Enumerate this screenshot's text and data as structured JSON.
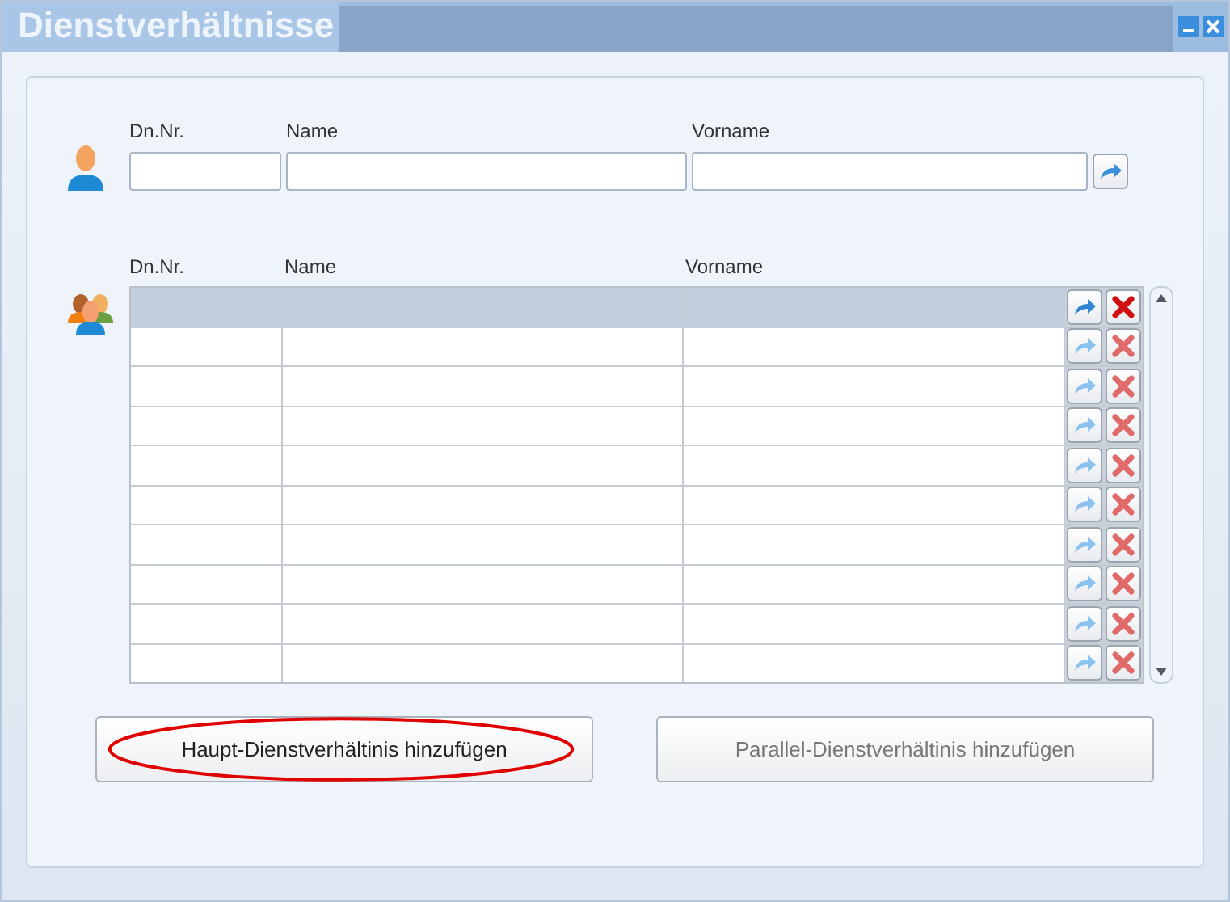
{
  "window": {
    "title": "Dienstverhältnisse"
  },
  "search": {
    "columns": [
      "Dn.Nr.",
      "Name",
      "Vorname"
    ]
  },
  "table": {
    "columns": [
      "Dn.Nr.",
      "Name",
      "Vorname"
    ],
    "rows": [
      {
        "selected": true
      },
      {
        "selected": false
      },
      {
        "selected": false
      },
      {
        "selected": false
      },
      {
        "selected": false
      },
      {
        "selected": false
      },
      {
        "selected": false
      },
      {
        "selected": false
      },
      {
        "selected": false
      },
      {
        "selected": false
      }
    ]
  },
  "buttons": [
    {
      "label": "Haupt-Dienstverhältinis hinzufügen",
      "disabled": false,
      "highlighted": true
    },
    {
      "label": "Parallel-Dienstverhältinis hinzufügen",
      "disabled": true,
      "highlighted": false
    }
  ]
}
